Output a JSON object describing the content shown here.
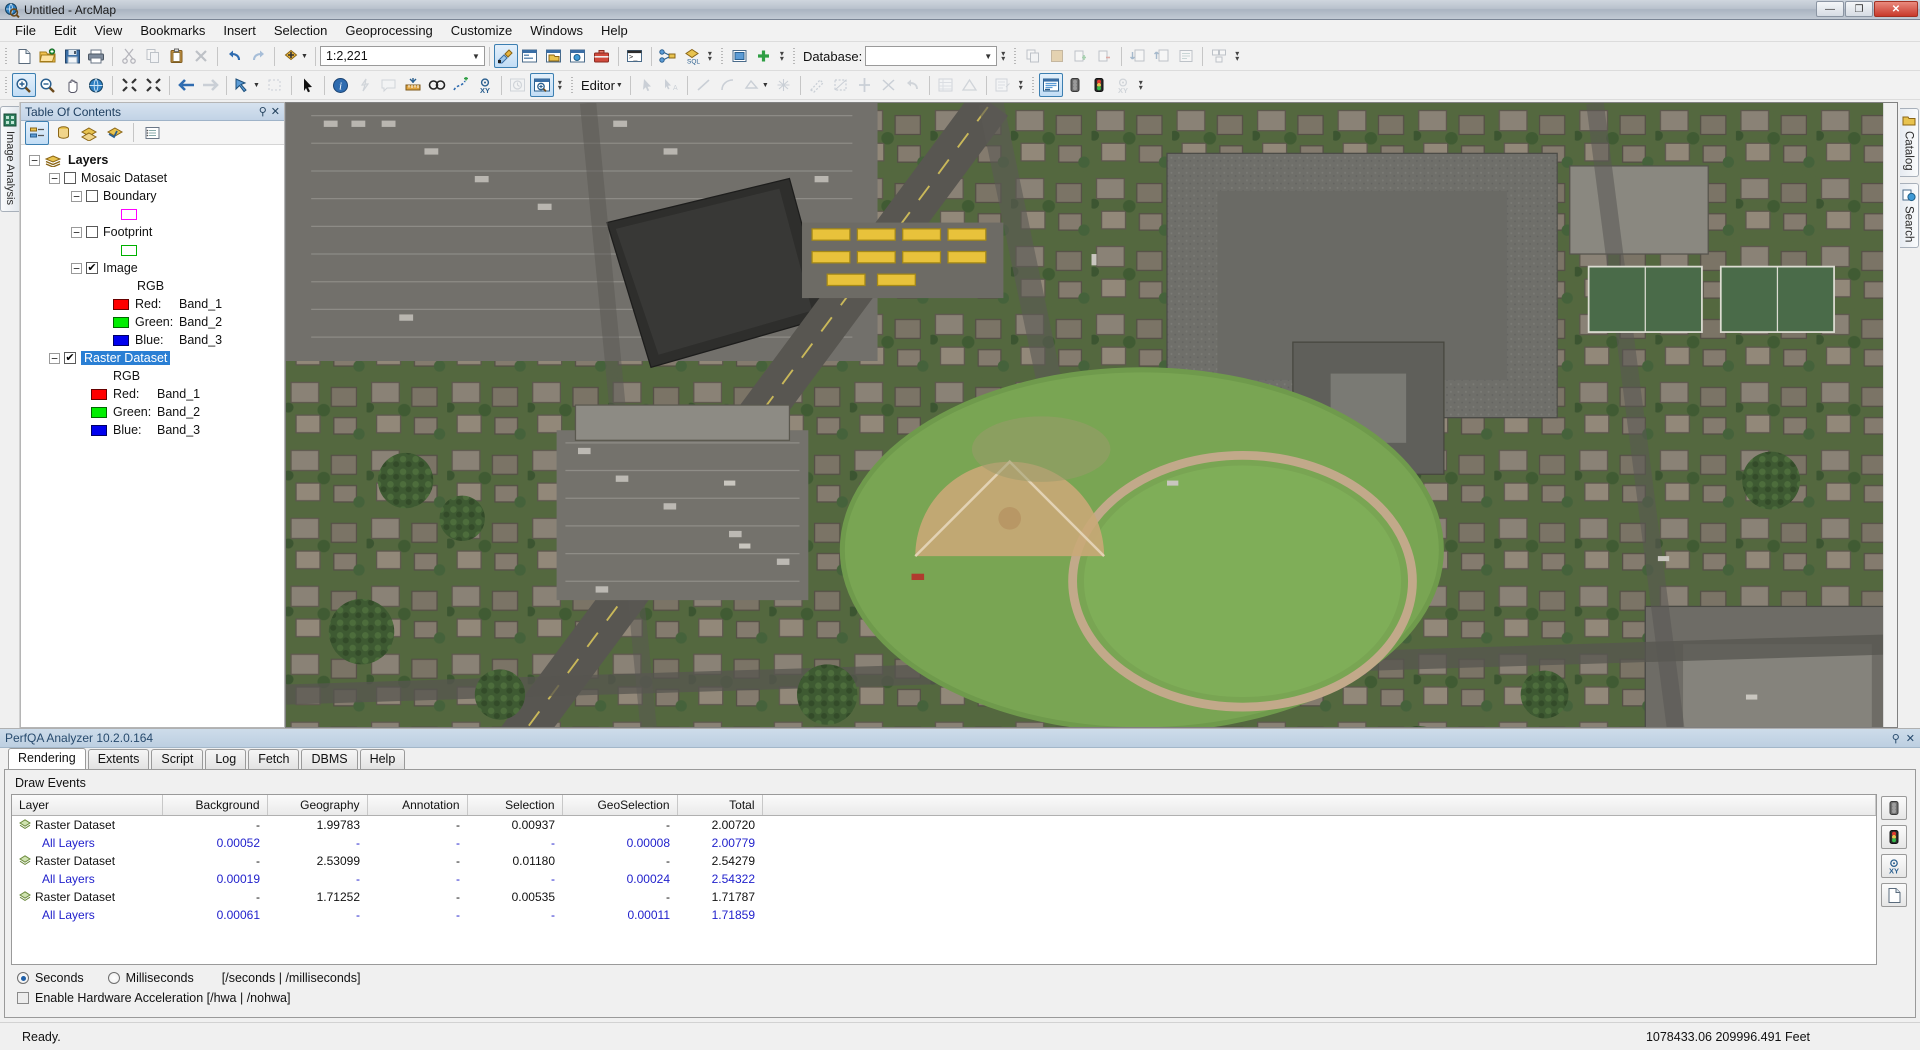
{
  "window": {
    "title": "Untitled - ArcMap",
    "app_icon": "arcmap-globe-icon",
    "minimize_label": "—",
    "maximize_label": "❐",
    "close_label": "✕"
  },
  "menubar": {
    "items": [
      {
        "label": "File"
      },
      {
        "label": "Edit"
      },
      {
        "label": "View"
      },
      {
        "label": "Bookmarks"
      },
      {
        "label": "Insert"
      },
      {
        "label": "Selection"
      },
      {
        "label": "Geoprocessing"
      },
      {
        "label": "Customize"
      },
      {
        "label": "Windows"
      },
      {
        "label": "Help"
      }
    ]
  },
  "toolbar_standard": {
    "scale_value": "1:2,221",
    "database_label": "Database:",
    "database_value": "",
    "buttons": [
      "new-document-icon",
      "open-folder-icon",
      "save-icon",
      "print-icon",
      "cut-icon",
      "copy-icon",
      "paste-icon",
      "delete-x-icon",
      "undo-icon",
      "redo-icon",
      "add-data-icon",
      "editor-toolbar-icon",
      "table-of-contents-icon",
      "catalog-window-icon",
      "search-window-icon",
      "arctoolbox-icon",
      "python-window-icon",
      "model-builder-icon",
      "sql-icon",
      "image-analysis-icon",
      "add-plus-icon"
    ]
  },
  "toolbar_tools": {
    "buttons": [
      "zoom-in-icon",
      "zoom-out-icon",
      "pan-icon",
      "full-extent-icon",
      "fixed-zoom-in-icon",
      "fixed-zoom-out-icon",
      "go-back-extent-icon",
      "go-forward-extent-icon",
      "select-features-icon",
      "clear-selection-icon",
      "select-elements-icon",
      "identify-icon",
      "hyperlink-icon",
      "html-popup-icon",
      "measure-icon",
      "find-icon",
      "find-route-icon",
      "go-to-xy-icon",
      "time-slider-icon",
      "create-viewer-window-icon"
    ],
    "editor_label": "Editor",
    "editor_buttons": [
      "edit-tool-icon",
      "edit-annotation-icon",
      "straight-segment-icon",
      "arc-segment-icon",
      "trace-icon",
      "construct-points-icon",
      "rotate-icon",
      "cut-polygons-icon",
      "split-icon",
      "merge-icon",
      "undo-edit-icon",
      "attributes-icon",
      "sketch-properties-icon",
      "create-features-icon"
    ],
    "perfqa_buttons": [
      "perfqa-analyzer-icon",
      "traffic-light-gray-icon",
      "traffic-light-color-icon",
      "xy-target-icon"
    ]
  },
  "left_strip": {
    "tabs": [
      {
        "label": "Image Analysis",
        "icon": "image-analysis-icon"
      }
    ]
  },
  "right_strip": {
    "tabs": [
      {
        "label": "Catalog",
        "icon": "catalog-icon"
      },
      {
        "label": "Search",
        "icon": "search-globe-icon"
      }
    ]
  },
  "toc": {
    "title": "Table Of Contents",
    "pin_label": "⚲",
    "close_label": "✕",
    "toolbar_buttons": [
      "list-by-drawing-order-icon",
      "list-by-source-icon",
      "list-by-visibility-icon",
      "list-by-selection-icon",
      "options-icon"
    ],
    "tree": [
      {
        "id": "layers",
        "label": "Layers",
        "indent": 0,
        "expander": "-",
        "icon": "layers-stack-icon",
        "bold": true
      },
      {
        "id": "mosaic-dataset",
        "label": "Mosaic Dataset",
        "indent": 1,
        "expander": "-",
        "checkbox": "unchecked"
      },
      {
        "id": "boundary",
        "label": "Boundary",
        "indent": 2,
        "expander": "-",
        "checkbox": "unchecked"
      },
      {
        "id": "boundary-symbol",
        "label": "",
        "indent": 4,
        "swatch": "#ff00ff",
        "swatch_style": "hollow"
      },
      {
        "id": "footprint",
        "label": "Footprint",
        "indent": 2,
        "expander": "-",
        "checkbox": "unchecked"
      },
      {
        "id": "footprint-symbol",
        "label": "",
        "indent": 4,
        "swatch": "#00b000",
        "swatch_style": "hollow"
      },
      {
        "id": "image",
        "label": "Image",
        "indent": 2,
        "expander": "-",
        "checkbox": "checked"
      },
      {
        "id": "rgb-1",
        "label": "RGB",
        "indent": 4
      },
      {
        "id": "red-band1",
        "label": "Red:",
        "value": "Band_1",
        "indent": 4,
        "swatch": "#ff0000"
      },
      {
        "id": "green-band2",
        "label": "Green:",
        "value": "Band_2",
        "indent": 4,
        "swatch": "#00ee00"
      },
      {
        "id": "blue-band3",
        "label": "Blue:",
        "value": "Band_3",
        "indent": 4,
        "swatch": "#0000ee"
      },
      {
        "id": "raster-dataset",
        "label": "Raster Dataset",
        "indent": 1,
        "expander": "-",
        "checkbox": "checked",
        "selected": true
      },
      {
        "id": "rgb-2",
        "label": "RGB",
        "indent": 3
      },
      {
        "id": "red-band1-b",
        "label": "Red:",
        "value": "Band_1",
        "indent": 3,
        "swatch": "#ff0000"
      },
      {
        "id": "green-band2-b",
        "label": "Green:",
        "value": "Band_2",
        "indent": 3,
        "swatch": "#00ee00"
      },
      {
        "id": "blue-band3-b",
        "label": "Blue:",
        "value": "Band_3",
        "indent": 3,
        "swatch": "#0000ee"
      }
    ]
  },
  "perfqa": {
    "title": "PerfQA Analyzer 10.2.0.164",
    "pin_label": "⚲",
    "close_label": "✕",
    "tabs": [
      {
        "label": "Rendering",
        "active": true
      },
      {
        "label": "Extents",
        "active": false
      },
      {
        "label": "Script",
        "active": false
      },
      {
        "label": "Log",
        "active": false
      },
      {
        "label": "Fetch",
        "active": false
      },
      {
        "label": "DBMS",
        "active": false
      },
      {
        "label": "Help",
        "active": false
      }
    ],
    "section_label": "Draw Events",
    "columns": [
      "Layer",
      "Background",
      "Geography",
      "Annotation",
      "Selection",
      "GeoSelection",
      "Total"
    ],
    "rows": [
      {
        "layer": "Raster Dataset",
        "type": "layer",
        "background": "-",
        "geography": "1.99783",
        "annotation": "-",
        "selection": "0.00937",
        "geoselection": "-",
        "total": "2.00720"
      },
      {
        "layer": "All Layers",
        "type": "sub",
        "background": "0.00052",
        "geography": "-",
        "annotation": "-",
        "selection": "-",
        "geoselection": "0.00008",
        "total": "2.00779"
      },
      {
        "layer": "Raster Dataset",
        "type": "layer",
        "background": "-",
        "geography": "2.53099",
        "annotation": "-",
        "selection": "0.01180",
        "geoselection": "-",
        "total": "2.54279"
      },
      {
        "layer": "All Layers",
        "type": "sub",
        "background": "0.00019",
        "geography": "-",
        "annotation": "-",
        "selection": "-",
        "geoselection": "0.00024",
        "total": "2.54322"
      },
      {
        "layer": "Raster Dataset",
        "type": "layer",
        "background": "-",
        "geography": "1.71252",
        "annotation": "-",
        "selection": "0.00535",
        "geoselection": "-",
        "total": "1.71787"
      },
      {
        "layer": "All Layers",
        "type": "sub",
        "background": "0.00061",
        "geography": "-",
        "annotation": "-",
        "selection": "-",
        "geoselection": "0.00011",
        "total": "1.71859"
      }
    ],
    "side_buttons": [
      "traffic-light-gray-icon",
      "traffic-light-color-icon",
      "xy-target-icon",
      "document-icon"
    ],
    "units": {
      "seconds_label": "Seconds",
      "seconds_selected": true,
      "milliseconds_label": "Milliseconds",
      "milliseconds_selected": false,
      "switch_hint": "[/seconds | /milliseconds]"
    },
    "hardware": {
      "label": "Enable Hardware Acceleration [/hwa | /nohwa]",
      "checked": false
    }
  },
  "statusbar": {
    "message": "Ready.",
    "coordinates": "1078433.06  209996.491 Feet"
  },
  "colors": {
    "accent": "#2a7fd4",
    "panel_title": "#274a6d",
    "sub_row_text": "#2222cc",
    "red_band": "#ff0000",
    "green_band": "#00ee00",
    "blue_band": "#0000ee",
    "boundary_outline": "#ff00ff",
    "footprint_outline": "#00b000"
  }
}
